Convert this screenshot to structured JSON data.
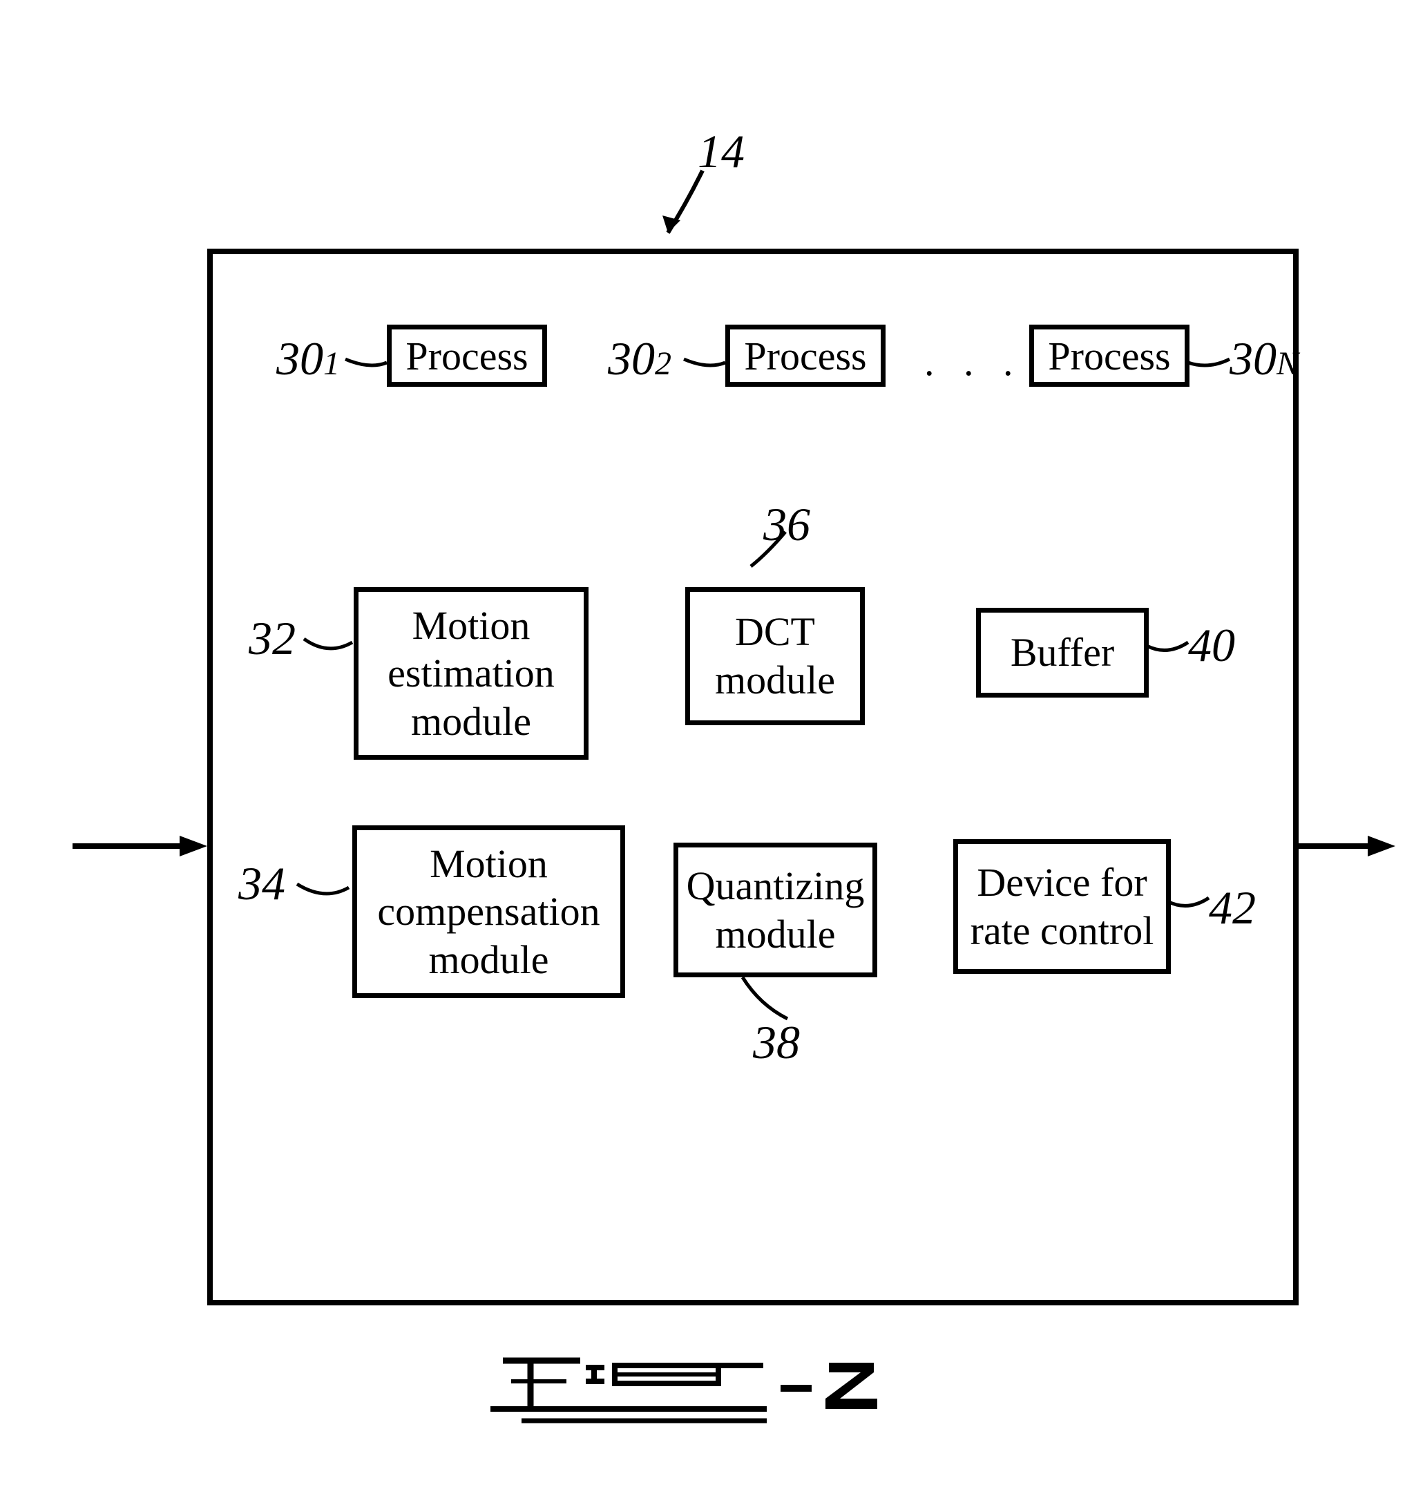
{
  "main_ref": "14",
  "process_row": {
    "label": "Process",
    "ellipsis": ". . .",
    "ref_prefix": "30",
    "sub1": "1",
    "sub2": "2",
    "subN": "N"
  },
  "modules": {
    "motion_estimation": "Motion\nestimation\nmodule",
    "ref_32": "32",
    "motion_compensation": "Motion\ncompensation\nmodule",
    "ref_34": "34",
    "dct": "DCT\nmodule",
    "ref_36": "36",
    "quantizing": "Quantizing\nmodule",
    "ref_38": "38",
    "buffer": "Buffer",
    "ref_40": "40",
    "rate_control": "Device for\nrate control",
    "ref_42": "42"
  },
  "figure_number": "2"
}
